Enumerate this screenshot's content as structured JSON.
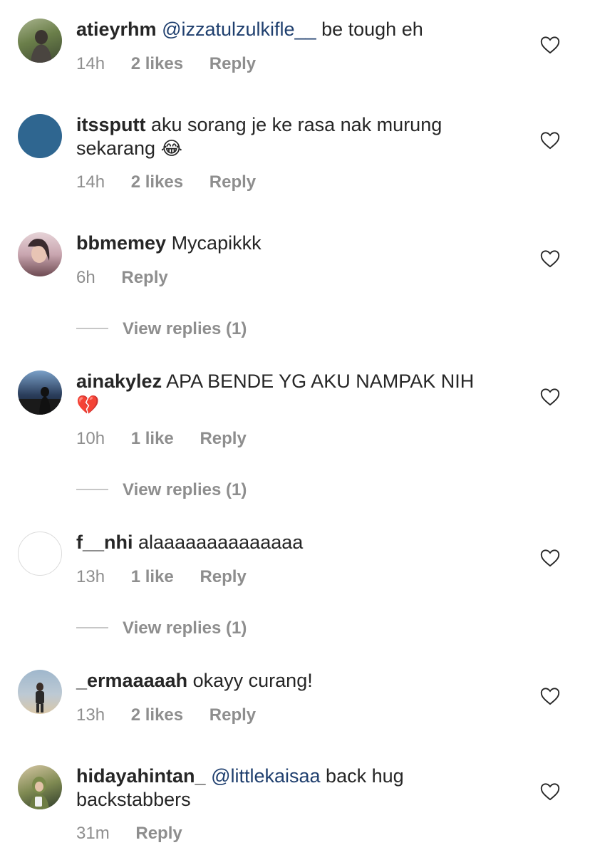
{
  "comments": [
    {
      "username": "atieyrhm",
      "mention": "@izzatulzulkifle__",
      "text": " be tough eh",
      "time": "14h",
      "likes": "2 likes",
      "reply": "Reply",
      "avatar_colors": [
        "#6b7f4a",
        "#3e4a32",
        "#a9b48e"
      ]
    },
    {
      "username": "itssputt",
      "text": " aku sorang je ke rasa nak murung sekarang ",
      "emoji": "😂",
      "time": "14h",
      "likes": "2 likes",
      "reply": "Reply",
      "avatar_colors": [
        "#2f6690",
        "#2f6690",
        "#2f6690"
      ]
    },
    {
      "username": "bbmemey",
      "text": " Mycapikkk",
      "time": "6h",
      "reply": "Reply",
      "view_replies": "View replies (1)",
      "avatar_colors": [
        "#c9a6b0",
        "#6e4b52",
        "#e6d3d7"
      ]
    },
    {
      "username": "ainakylez",
      "text": " APA BENDE YG AKU NAMPAK NIH ",
      "emoji": "💔",
      "time": "10h",
      "likes": "1 like",
      "reply": "Reply",
      "view_replies": "View replies (1)",
      "avatar_colors": [
        "#2b3e5c",
        "#0f1624",
        "#7aa0c8"
      ]
    },
    {
      "username": "f__nhi",
      "text": " alaaaaaaaaaaaaaa",
      "time": "13h",
      "likes": "1 like",
      "reply": "Reply",
      "view_replies": "View replies (1)",
      "avatar_colors": [
        "#ffffff",
        "#ffffff",
        "#ffffff"
      ]
    },
    {
      "username": "_ermaaaaah",
      "text": " okayy curang!",
      "time": "13h",
      "likes": "2 likes",
      "reply": "Reply",
      "avatar_colors": [
        "#9fb7cc",
        "#3a3a3a",
        "#d9c7a8"
      ]
    },
    {
      "username": "hidayahintan_",
      "mention": "@littlekaisaa",
      "text": " back hug backstabbers",
      "time": "31m",
      "reply": "Reply",
      "avatar_colors": [
        "#7f8a52",
        "#2d3a2a",
        "#d8c8a6"
      ]
    }
  ]
}
